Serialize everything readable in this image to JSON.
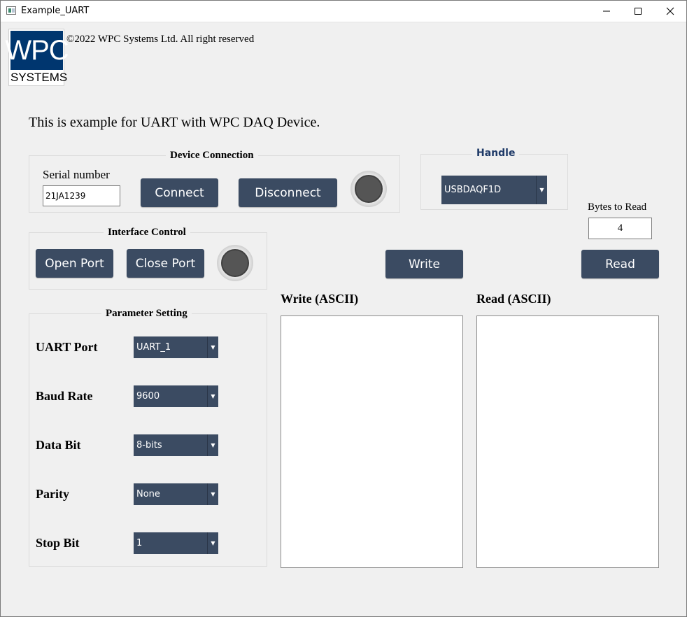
{
  "window": {
    "title": "Example_UART",
    "controls": {
      "minimize": "minimize-icon",
      "maximize": "maximize-icon",
      "close": "close-icon"
    }
  },
  "logo": {
    "top": "WPC",
    "bottom": "SYSTEMS",
    "color": "#00366f"
  },
  "copyright": "©2022 WPC Systems Ltd. All right reserved",
  "intro": "This is example for UART with WPC DAQ Device.",
  "device_connection": {
    "title": "Device Connection",
    "serial_label": "Serial number",
    "serial_value": "21JA1239",
    "connect_label": "Connect",
    "disconnect_label": "Disconnect",
    "led_state": "off"
  },
  "handle": {
    "title": "Handle",
    "selected": "USBDAQF1D"
  },
  "interface_control": {
    "title": "Interface Control",
    "open_label": "Open Port",
    "close_label": "Close Port",
    "led_state": "off"
  },
  "bytes_to_read": {
    "label": "Bytes to Read",
    "value": "4"
  },
  "actions": {
    "write_label": "Write",
    "read_label": "Read"
  },
  "write_area": {
    "label": "Write (ASCII)",
    "value": ""
  },
  "read_area": {
    "label": "Read (ASCII)",
    "value": ""
  },
  "parameter_setting": {
    "title": "Parameter Setting",
    "rows": [
      {
        "label": "UART Port",
        "value": "UART_1"
      },
      {
        "label": "Baud Rate",
        "value": "9600"
      },
      {
        "label": "Data Bit",
        "value": "8-bits"
      },
      {
        "label": "Parity",
        "value": "None"
      },
      {
        "label": "Stop Bit",
        "value": "1"
      }
    ]
  },
  "colors": {
    "button": "#3b4b62",
    "background": "#f0f0f0",
    "handle_title": "#1f3a68"
  }
}
